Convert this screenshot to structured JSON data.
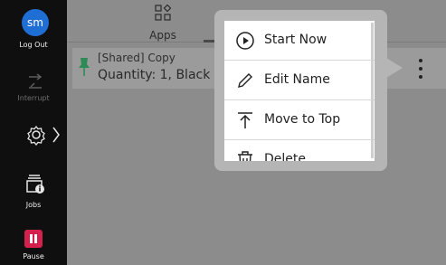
{
  "sidebar": {
    "avatar_initials": "sm",
    "avatar_color": "#1f6ed4",
    "logout_label": "Log Out",
    "interrupt_label": "Interrupt",
    "jobs_label": "Jobs",
    "pause_label": "Pause",
    "pause_color": "#d4204d"
  },
  "tabs": {
    "apps_label": "Apps"
  },
  "job": {
    "name": "[Shared] Copy",
    "detail": "Quantity: 1, Black &",
    "pin_color": "#2e8b57"
  },
  "menu": {
    "items": [
      {
        "label": "Start Now",
        "icon": "play-circle-icon"
      },
      {
        "label": "Edit Name",
        "icon": "pencil-icon"
      },
      {
        "label": "Move to Top",
        "icon": "move-to-top-icon"
      },
      {
        "label": "Delete",
        "icon": "trash-icon"
      }
    ]
  }
}
